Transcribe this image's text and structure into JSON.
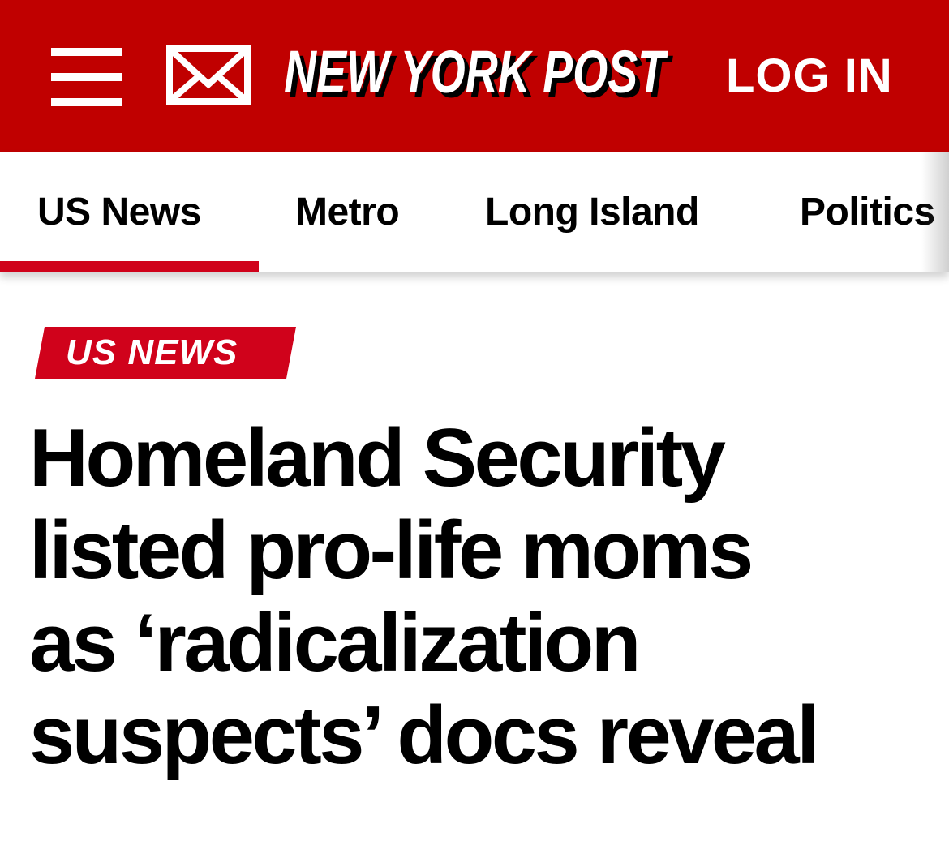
{
  "header": {
    "background_color": "#c00000",
    "menu_icon": "hamburger-menu-icon",
    "mail_icon": "envelope-icon",
    "logo_text": "NEW YORK POST",
    "login_label": "LOG IN"
  },
  "nav": {
    "items": [
      {
        "label": "US News",
        "active": true
      },
      {
        "label": "Metro",
        "active": false
      },
      {
        "label": "Long Island",
        "active": false
      },
      {
        "label": "Politics",
        "active": false
      }
    ],
    "active_indicator_color": "#d0021b"
  },
  "article": {
    "section_tag": "US NEWS",
    "section_tag_color": "#d0021b",
    "headline_lines": [
      "Homeland Security",
      "listed pro-life moms",
      "as ‘radicalization",
      "suspects’ docs reveal"
    ]
  }
}
